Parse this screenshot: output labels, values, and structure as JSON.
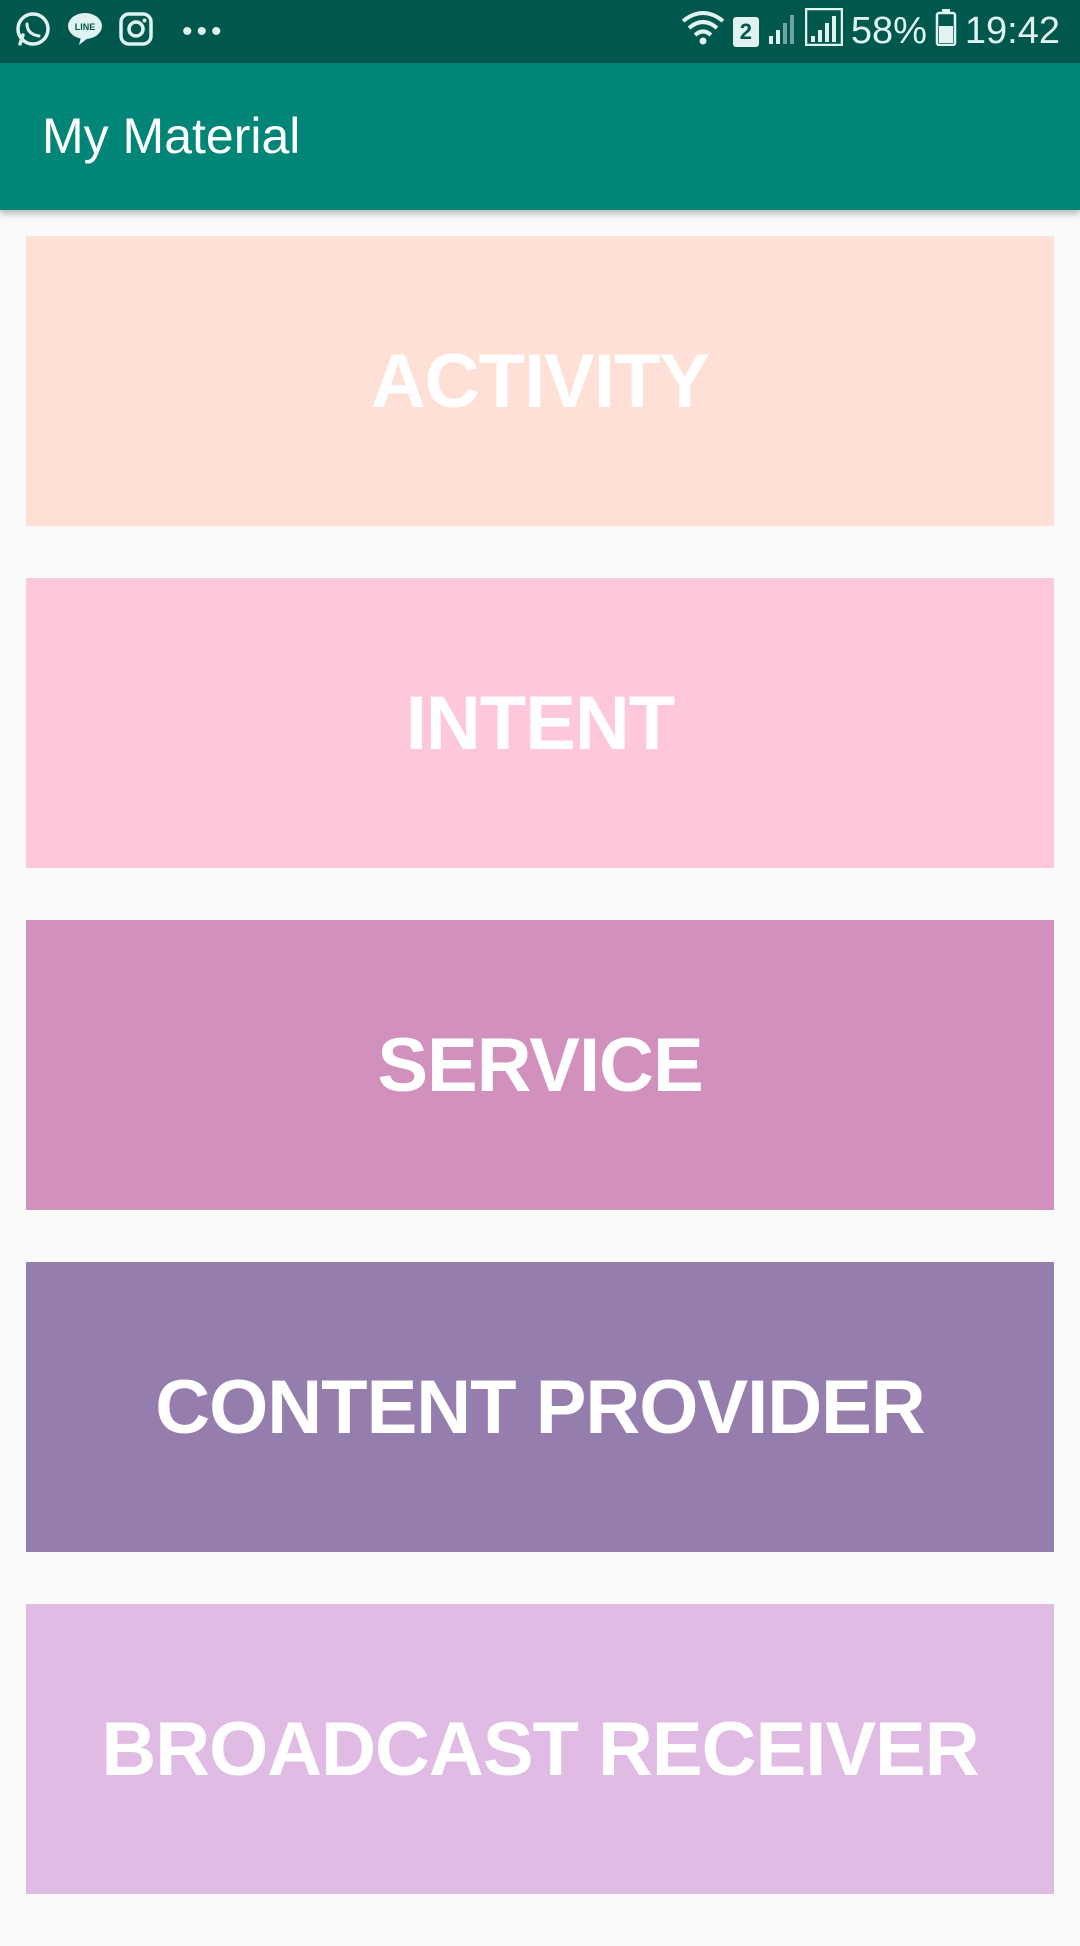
{
  "status_bar": {
    "notification_icons": [
      "whatsapp-icon",
      "line-icon",
      "instagram-icon"
    ],
    "more_label": "•••",
    "sim_badge": "2",
    "battery_pct": "58%",
    "time": "19:42"
  },
  "app_bar": {
    "title": "My Material"
  },
  "tiles": [
    {
      "label": "ACTIVITY",
      "color": "#ffe0d6"
    },
    {
      "label": "INTENT",
      "color": "#fec8d8"
    },
    {
      "label": "SERVICE",
      "color": "#d291bc"
    },
    {
      "label": "CONTENT PROVIDER",
      "color": "#957dad"
    },
    {
      "label": "BROADCAST RECEIVER",
      "color": "#e0bbe4"
    }
  ],
  "colors": {
    "status_bar": "#00574b",
    "app_bar": "#008577",
    "background": "#fafafa"
  }
}
